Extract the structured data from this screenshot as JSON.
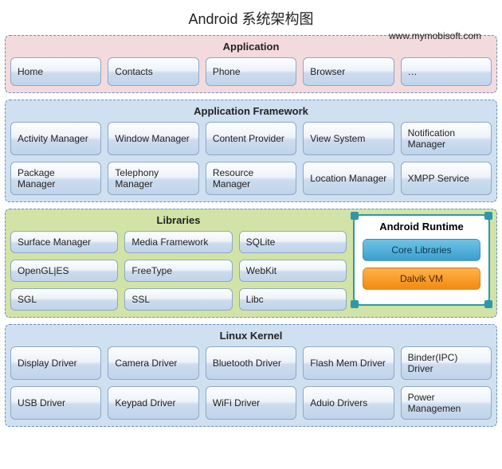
{
  "title": "Android  系统架构图",
  "url": "www.mymobisoft.com",
  "layers": {
    "application": {
      "title": "Application",
      "items": [
        "Home",
        "Contacts",
        "Phone",
        "Browser",
        "…"
      ]
    },
    "framework": {
      "title": "Application Framework",
      "row1": [
        "Activity Manager",
        "Window Manager",
        "Content Provider",
        "View System",
        "Notification Manager"
      ],
      "row2": [
        "Package Manager",
        "Telephony Manager",
        "Resource Manager",
        "Location Manager",
        "XMPP Service"
      ]
    },
    "libraries": {
      "title": "Libraries",
      "row1": [
        "Surface Manager",
        "Media Framework",
        "SQLite"
      ],
      "row2": [
        "OpenGL|ES",
        "FreeType",
        "WebKit"
      ],
      "row3": [
        "SGL",
        "SSL",
        "Libc"
      ]
    },
    "runtime": {
      "title": "Android Runtime",
      "core": "Core Libraries",
      "dalvik": "Dalvik VM"
    },
    "kernel": {
      "title": "Linux Kernel",
      "row1": [
        "Display Driver",
        "Camera Driver",
        "Bluetooth Driver",
        "Flash Mem Driver",
        "Binder(IPC) Driver"
      ],
      "row2": [
        "USB Driver",
        "Keypad Driver",
        "WiFi Driver",
        "Aduio Drivers",
        "Power Managemen"
      ]
    }
  }
}
